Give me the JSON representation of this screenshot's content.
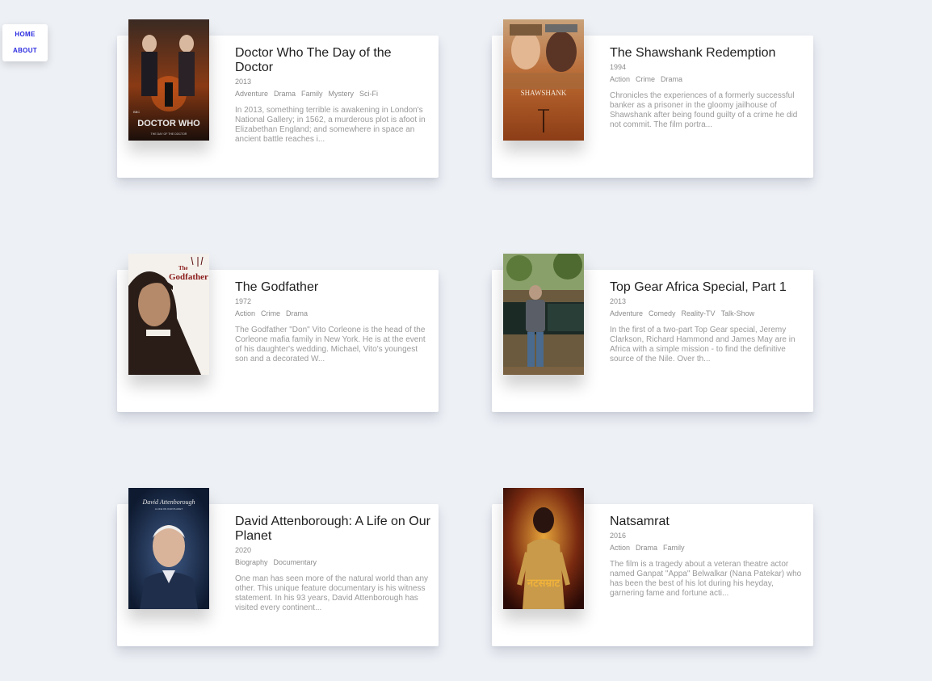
{
  "nav": {
    "home": "HOME",
    "about": "ABOUT"
  },
  "movies": [
    {
      "title": "Doctor Who The Day of the Doctor",
      "year": "2013",
      "genres": [
        "Adventure",
        "Drama",
        "Family",
        "Mystery",
        "Sci-Fi"
      ],
      "description": "In 2013, something terrible is awakening in London's National Gallery; in 1562, a murderous plot is afoot in Elizabethan England; and somewhere in space an ancient battle reaches i...",
      "poster": {
        "top_text": "BBC",
        "main_text": "DOCTOR WHO",
        "sub_text": "THE DAY OF THE DOCTOR"
      }
    },
    {
      "title": "The Shawshank Redemption",
      "year": "1994",
      "genres": [
        "Action",
        "Crime",
        "Drama"
      ],
      "description": "Chronicles the experiences of a formerly successful banker as a prisoner in the gloomy jailhouse of Shawshank after being found guilty of a crime he did not commit. The film portra...",
      "poster": {
        "main_text": "SHAWSHANK"
      }
    },
    {
      "title": "The Godfather",
      "year": "1972",
      "genres": [
        "Action",
        "Crime",
        "Drama"
      ],
      "description": "The Godfather \"Don\" Vito Corleone is the head of the Corleone mafia family in New York. He is at the event of his daughter's wedding. Michael, Vito's youngest son and a decorated W...",
      "poster": {
        "small_text": "The",
        "main_text": "Godfather"
      }
    },
    {
      "title": "Top Gear Africa Special, Part 1",
      "year": "2013",
      "genres": [
        "Adventure",
        "Comedy",
        "Reality-TV",
        "Talk-Show"
      ],
      "description": "In the first of a two-part Top Gear special, Jeremy Clarkson, Richard Hammond and James May are in Africa with a simple mission - to find the definitive source of the Nile. Over th...",
      "poster": {}
    },
    {
      "title": "David Attenborough: A Life on Our Planet",
      "year": "2020",
      "genres": [
        "Biography",
        "Documentary"
      ],
      "description": "One man has seen more of the natural world than any other. This unique feature documentary is his witness statement. In his 93 years, David Attenborough has visited every continent...",
      "poster": {
        "main_text": "David Attenborough",
        "sub_text": "A LIFE ON OUR PLANET"
      }
    },
    {
      "title": "Natsamrat",
      "year": "2016",
      "genres": [
        "Action",
        "Drama",
        "Family"
      ],
      "description": "The film is a tragedy about a veteran theatre actor named Ganpat \"Appa\" Belwalkar (Nana Patekar) who has been the best of his lot during his heyday, garnering fame and fortune acti...",
      "poster": {
        "main_text": "नटसम्राट"
      }
    }
  ]
}
